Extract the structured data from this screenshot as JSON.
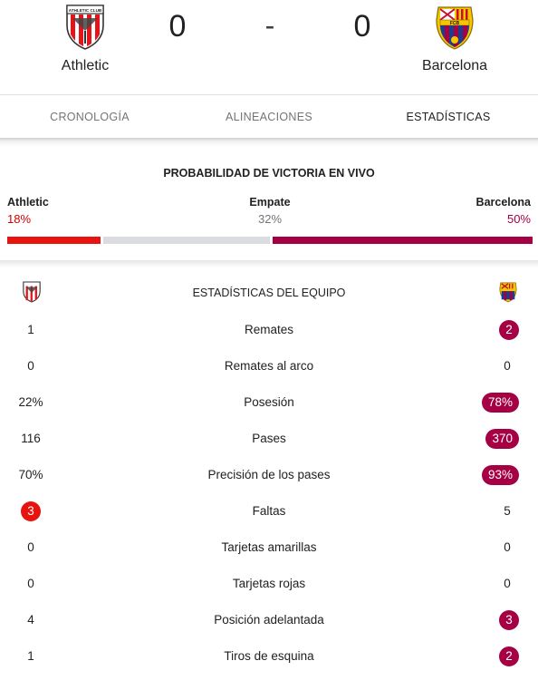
{
  "match": {
    "home_team": "Athletic",
    "away_team": "Barcelona",
    "home_score": "0",
    "away_score": "0",
    "separator": "-",
    "home_crest_icon": "athletic-club-crest-icon",
    "away_crest_icon": "fc-barcelona-crest-icon",
    "home_crest_text": "ATHLETIC CLUB",
    "away_crest_text": "FCB"
  },
  "tabs": [
    {
      "label": "CRONOLOGÍA",
      "active": false
    },
    {
      "label": "ALINEACIONES",
      "active": false
    },
    {
      "label": "ESTADÍSTICAS",
      "active": true
    }
  ],
  "win_probability": {
    "title": "PROBABILIDAD DE VICTORIA EN VIVO",
    "home_label": "Athletic",
    "home_pct": "18%",
    "draw_label": "Empate",
    "draw_pct": "32%",
    "away_label": "Barcelona",
    "away_pct": "50%",
    "home_fraction": 0.18,
    "draw_fraction": 0.32,
    "away_fraction": 0.5
  },
  "team_stats": {
    "title": "ESTADÍSTICAS DEL EQUIPO",
    "rows": [
      {
        "label": "Remates",
        "home": "1",
        "away": "2",
        "highlight": "away"
      },
      {
        "label": "Remates al arco",
        "home": "0",
        "away": "0",
        "highlight": "none"
      },
      {
        "label": "Posesión",
        "home": "22%",
        "away": "78%",
        "highlight": "away"
      },
      {
        "label": "Pases",
        "home": "116",
        "away": "370",
        "highlight": "away"
      },
      {
        "label": "Precisión de los pases",
        "home": "70%",
        "away": "93%",
        "highlight": "away"
      },
      {
        "label": "Faltas",
        "home": "3",
        "away": "5",
        "highlight": "home"
      },
      {
        "label": "Tarjetas amarillas",
        "home": "0",
        "away": "0",
        "highlight": "none"
      },
      {
        "label": "Tarjetas rojas",
        "home": "0",
        "away": "0",
        "highlight": "none"
      },
      {
        "label": "Posición adelantada",
        "home": "4",
        "away": "3",
        "highlight": "away"
      },
      {
        "label": "Tiros de esquina",
        "home": "1",
        "away": "2",
        "highlight": "away"
      }
    ]
  },
  "colors": {
    "home_accent": "#e8130f",
    "away_accent": "#a50044",
    "draw_bar": "#dadce0"
  }
}
